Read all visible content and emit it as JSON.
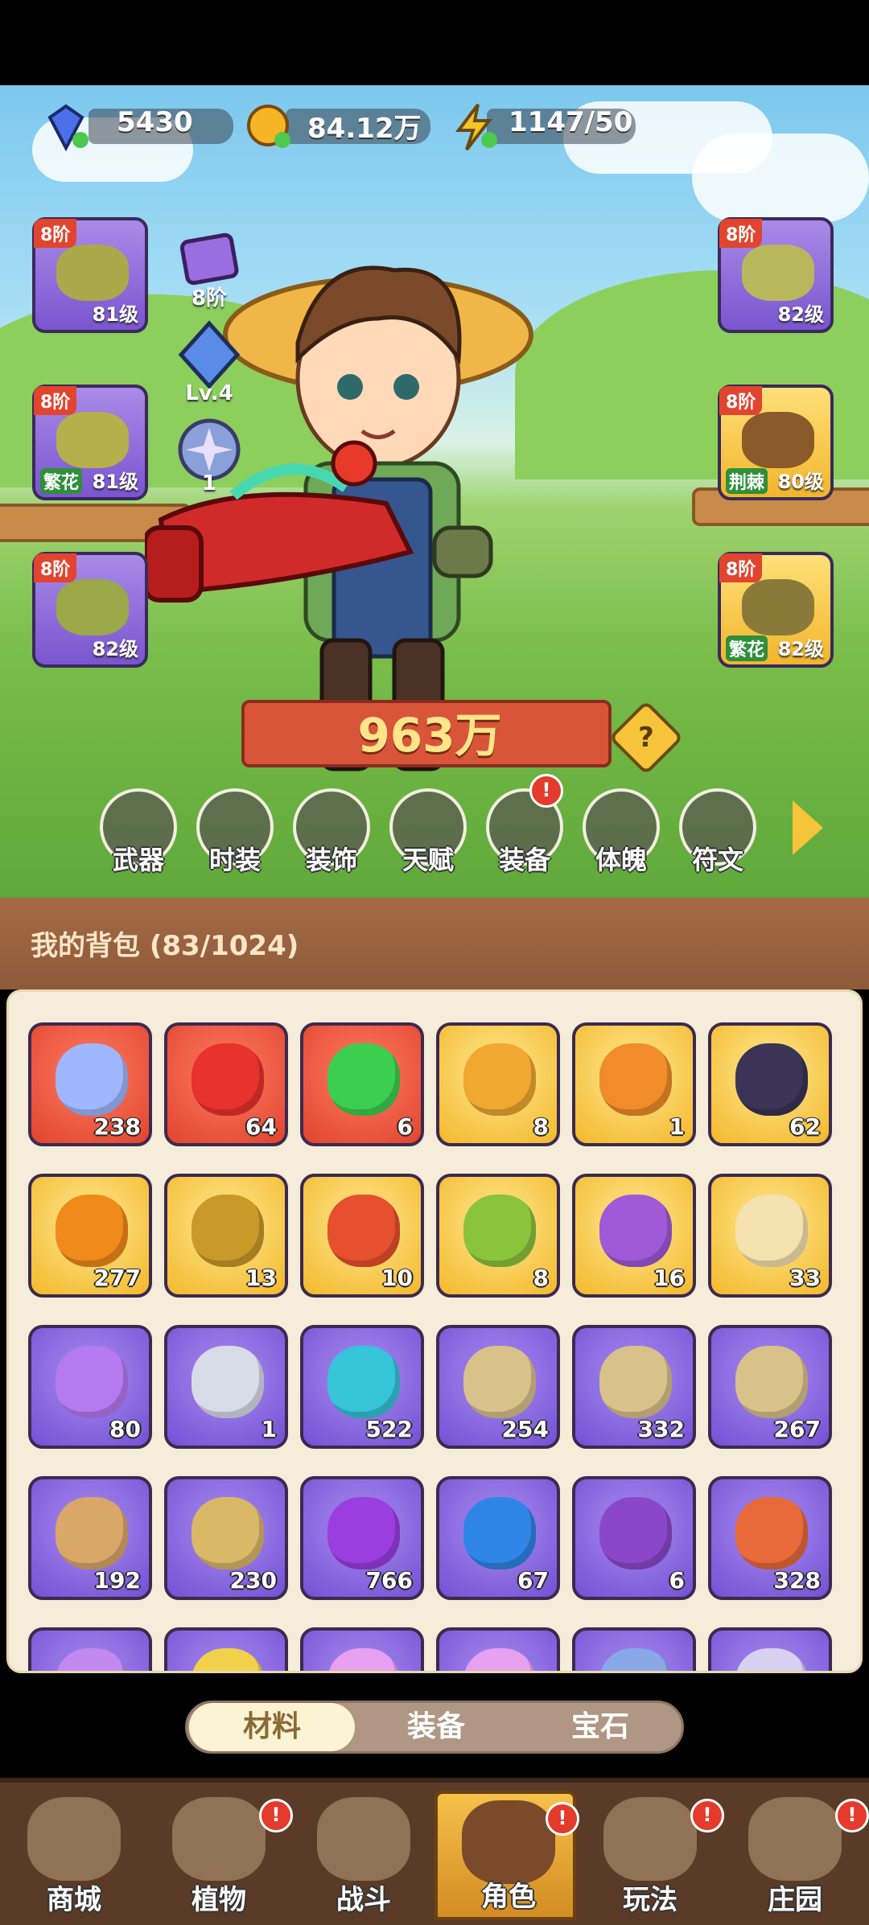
{
  "resources": {
    "gems": "5430",
    "gold": "84.12万",
    "energy": "1147/50"
  },
  "left_equipment": [
    {
      "tier": "8阶",
      "level": "81级",
      "tag": ""
    },
    {
      "tier": "8阶",
      "level": "81级",
      "tag": "繁花"
    },
    {
      "tier": "8阶",
      "level": "82级",
      "tag": ""
    }
  ],
  "right_equipment": [
    {
      "tier": "8阶",
      "level": "82级",
      "tag": ""
    },
    {
      "tier": "8阶",
      "level": "80级",
      "tag": "荆棘"
    },
    {
      "tier": "8阶",
      "level": "82级",
      "tag": "繁花"
    }
  ],
  "mini_stats": {
    "chest_label": "8阶",
    "crystal_label": "Lv.4",
    "orb_label": "1"
  },
  "power": "963万",
  "help_symbol": "?",
  "nav_buttons": [
    {
      "label": "武器"
    },
    {
      "label": "时装"
    },
    {
      "label": "装饰"
    },
    {
      "label": "天赋"
    },
    {
      "label": "装备",
      "badge": "!"
    },
    {
      "label": "体魄"
    },
    {
      "label": "符文"
    }
  ],
  "backpack": {
    "title": "我的背包 (83/1024)"
  },
  "items": [
    {
      "rarity": "red",
      "count": "238",
      "icon": "blue-star-crystal",
      "color": "#9fb7ff"
    },
    {
      "rarity": "red",
      "count": "64",
      "icon": "red-potion",
      "color": "#e8322c"
    },
    {
      "rarity": "red",
      "count": "6",
      "icon": "green-canister",
      "color": "#3ccf4f"
    },
    {
      "rarity": "gold",
      "count": "8",
      "icon": "gold-key",
      "color": "#f0a830"
    },
    {
      "rarity": "gold",
      "count": "1",
      "icon": "gold-key-gem",
      "color": "#f08d2a"
    },
    {
      "rarity": "gold",
      "count": "62",
      "icon": "rune-stone",
      "color": "#3b3456"
    },
    {
      "rarity": "gold",
      "count": "277",
      "icon": "orange-potion",
      "color": "#f08a1a"
    },
    {
      "rarity": "gold",
      "count": "13",
      "icon": "golden-nugget",
      "color": "#c99a2a"
    },
    {
      "rarity": "gold",
      "count": "10",
      "icon": "red-flower-bulb",
      "color": "#e6502e"
    },
    {
      "rarity": "gold",
      "count": "8",
      "icon": "green-sprayer",
      "color": "#8ac43c"
    },
    {
      "rarity": "gold",
      "count": "16",
      "icon": "purple-book",
      "color": "#a05ad8"
    },
    {
      "rarity": "gold",
      "count": "33",
      "icon": "knot-emblem",
      "color": "#f4e2b0"
    },
    {
      "rarity": "purple",
      "count": "80",
      "icon": "purple-perfume",
      "color": "#b57af0"
    },
    {
      "rarity": "purple",
      "count": "1",
      "icon": "silver-key",
      "color": "#d8dce8"
    },
    {
      "rarity": "purple",
      "count": "522",
      "icon": "teal-leaf",
      "color": "#36c4d8"
    },
    {
      "rarity": "purple",
      "count": "254",
      "icon": "green-scroll",
      "color": "#d9c28a"
    },
    {
      "rarity": "purple",
      "count": "332",
      "icon": "purple-scroll",
      "color": "#d9c28a"
    },
    {
      "rarity": "purple",
      "count": "267",
      "icon": "blue-scroll",
      "color": "#d9c28a"
    },
    {
      "rarity": "purple",
      "count": "192",
      "icon": "fire-scroll",
      "color": "#d9a868"
    },
    {
      "rarity": "purple",
      "count": "230",
      "icon": "lightning-scroll",
      "color": "#d9b868"
    },
    {
      "rarity": "purple",
      "count": "766",
      "icon": "purple-potion",
      "color": "#9a3ee0"
    },
    {
      "rarity": "purple",
      "count": "67",
      "icon": "blue-bud",
      "color": "#2f86e6"
    },
    {
      "rarity": "purple",
      "count": "6",
      "icon": "purple-flower",
      "color": "#8a48c8"
    },
    {
      "rarity": "purple",
      "count": "328",
      "icon": "fruit-bowl",
      "color": "#e86a3a"
    },
    {
      "rarity": "purple",
      "count": "",
      "icon": "purple-gem",
      "color": "#c28af0"
    },
    {
      "rarity": "purple",
      "count": "",
      "icon": "yellow-gem",
      "color": "#f2d24a"
    },
    {
      "rarity": "purple",
      "count": "",
      "icon": "pink-gem",
      "color": "#e8a0f0"
    },
    {
      "rarity": "purple",
      "count": "",
      "icon": "pink-gem",
      "color": "#e8a0f0"
    },
    {
      "rarity": "purple",
      "count": "",
      "icon": "blue-shard",
      "color": "#8aa8e8"
    },
    {
      "rarity": "purple",
      "count": "",
      "icon": "white-shard",
      "color": "#d8d0f0"
    }
  ],
  "bag_tabs": [
    {
      "label": "材料",
      "active": true
    },
    {
      "label": "装备",
      "active": false
    },
    {
      "label": "宝石",
      "active": false
    }
  ],
  "bottom_nav": [
    {
      "label": "商城",
      "badge": ""
    },
    {
      "label": "植物",
      "badge": "!"
    },
    {
      "label": "战斗",
      "badge": ""
    },
    {
      "label": "角色",
      "badge": "!",
      "active": true
    },
    {
      "label": "玩法",
      "badge": "!"
    },
    {
      "label": "庄园",
      "badge": "!"
    }
  ]
}
